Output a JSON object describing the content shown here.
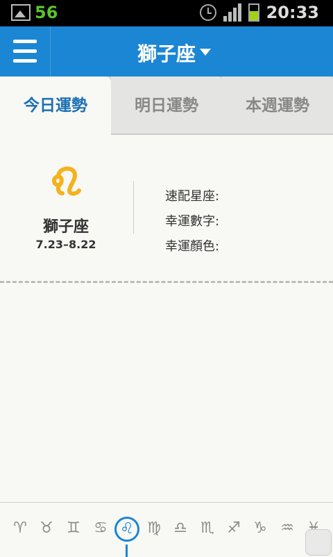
{
  "status": {
    "notification_count": "56",
    "time": "20:33"
  },
  "header": {
    "title": "獅子座"
  },
  "tabs": [
    {
      "label": "今日運勢"
    },
    {
      "label": "明日運勢"
    },
    {
      "label": "本週運勢"
    }
  ],
  "sign": {
    "name": "獅子座",
    "dates": "7.23–8.22"
  },
  "attributes": [
    {
      "label": "速配星座:"
    },
    {
      "label": "幸運數字:"
    },
    {
      "label": "幸運顏色:"
    }
  ],
  "zodiac": [
    "♈",
    "♉",
    "♊",
    "♋",
    "♌",
    "♍",
    "♎",
    "♏",
    "♐",
    "♑",
    "♒",
    "♓"
  ],
  "colors": {
    "accent": "#1b86d4",
    "leo_icon": "#f5b21d"
  }
}
